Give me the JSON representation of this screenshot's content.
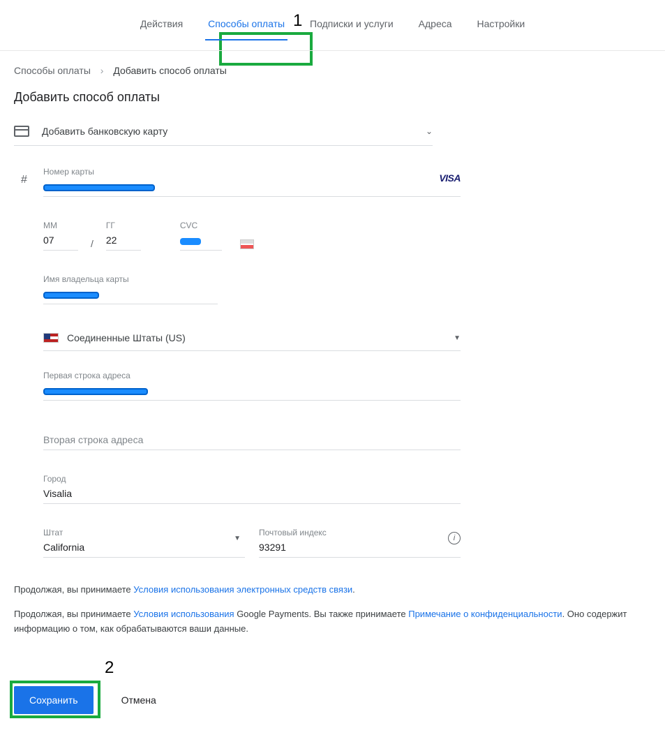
{
  "annotations": {
    "one": "1",
    "two": "2"
  },
  "tabs": {
    "actions": "Действия",
    "paymentMethods": "Способы оплаты",
    "subscriptions": "Подписки и услуги",
    "addresses": "Адреса",
    "settings": "Настройки"
  },
  "breadcrumb": {
    "parent": "Способы оплаты",
    "current": "Добавить способ оплаты"
  },
  "pageTitle": "Добавить способ оплаты",
  "methodSelect": "Добавить банковскую карту",
  "card": {
    "numberLabel": "Номер карты",
    "brand": "VISA",
    "mmLabel": "ММ",
    "mm": "07",
    "yyLabel": "ГГ",
    "yy": "22",
    "cvcLabel": "CVC",
    "holderLabel": "Имя владельца карты"
  },
  "address": {
    "country": "Соединенные Штаты (US)",
    "line1Label": "Первая строка адреса",
    "line2Placeholder": "Вторая строка адреса",
    "cityLabel": "Город",
    "city": "Visalia",
    "stateLabel": "Штат",
    "state": "California",
    "zipLabel": "Почтовый индекс",
    "zip": "93291"
  },
  "terms": {
    "line1a": "Продолжая, вы принимаете ",
    "link1": "Условия использования электронных средств связи",
    "line2a": "Продолжая, вы принимаете ",
    "link2": "Условия использования",
    "line2b": " Google Payments. Вы также принимаете ",
    "link3": "Примечание о конфиденциальности",
    "line2c": ". Оно содержит информацию о том, как обрабатываются ваши данные."
  },
  "actions": {
    "save": "Сохранить",
    "cancel": "Отмена"
  }
}
